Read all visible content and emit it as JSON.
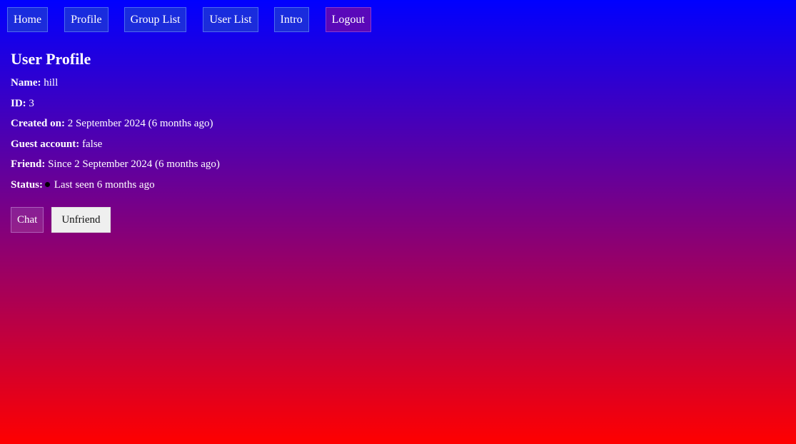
{
  "nav": {
    "home": "Home",
    "profile": "Profile",
    "group_list": "Group List",
    "user_list": "User List",
    "intro": "Intro",
    "logout": "Logout"
  },
  "profile": {
    "title": "User Profile",
    "name_label": "Name:",
    "name_value": "hill",
    "id_label": "ID:",
    "id_value": "3",
    "created_label": "Created on:",
    "created_value": "2 September 2024 (6 months ago)",
    "guest_label": "Guest account:",
    "guest_value": "false",
    "friend_label": "Friend:",
    "friend_value": "Since 2 September 2024 (6 months ago)",
    "status_label": "Status:",
    "status_value": "Last seen 6 months ago",
    "status_color": "#000000"
  },
  "actions": {
    "chat": "Chat",
    "unfriend": "Unfriend"
  },
  "colors": {
    "gradient_top": "#0000ff",
    "gradient_bottom": "#ff0000"
  }
}
